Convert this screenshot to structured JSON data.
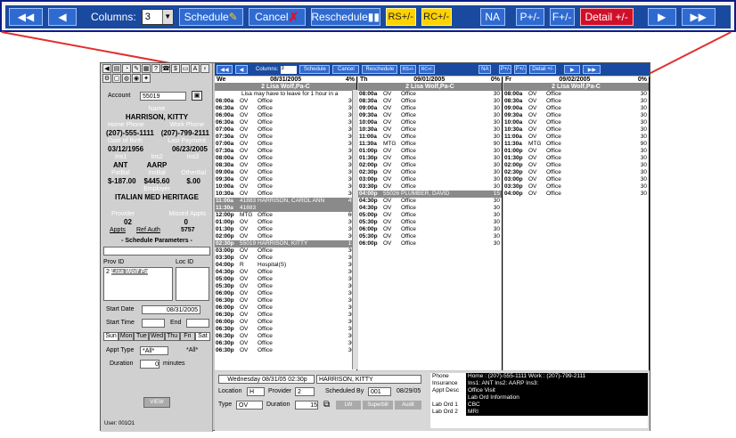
{
  "zoom": {
    "columns_label": "Columns:",
    "columns_value": "3",
    "schedule": "Schedule",
    "cancel": "Cancel",
    "reschedule": "Reschedule",
    "rs": "RS+/-",
    "rc": "RC+/-",
    "na": "NA",
    "p": "P+/-",
    "f": "F+/-",
    "detail": "Detail +/-"
  },
  "left": {
    "account_label": "Account",
    "account": "55019",
    "name_label": "Name",
    "name": "HARRISON, KITTY",
    "home_label": "Home Phone",
    "work_label": "Work Phone",
    "home": "(207)-555-1111",
    "work": "(207)-799-2111",
    "dob_label": "Date of Birth",
    "lastpay_label": "Last Payment",
    "dob": "03/12/1956",
    "lastpay": "06/23/2005",
    "ins1_label": "Ins1",
    "ins2_label": "Ins2",
    "ins3_label": "Ins3",
    "ins1": "ANT",
    "ins2": "AARP",
    "pat_label": "PatBal",
    "ins_label": "InsBal",
    "oth_label": "OtherBal",
    "pat": "$-187.00",
    "insbal": "$445.60",
    "oth": "$.00",
    "employer_label": "Employer",
    "employer": "ITALIAN MED HERITAGE",
    "prov_label": "Provider",
    "missed_label": "Missed Appts",
    "prov": "02",
    "missed": "0",
    "appts": "Appts",
    "refauth": "Ref Auth",
    "refnum": "5757",
    "sched_params": "- Schedule Parameters -",
    "provid": "Prov ID",
    "locid": "Loc ID",
    "provsel": "2",
    "provname": "Lisa Wolf Pa",
    "startdate_label": "Start Date",
    "startdate": "08/31/2005",
    "starttime_label": "Start Time",
    "end_label": "End",
    "days": [
      "Sun",
      "Mon",
      "Tue",
      "Wed",
      "Thu",
      "Fri",
      "Sat"
    ],
    "appttype_label": "Appt Type",
    "appttype": "*All*",
    "appttype2": "*All*",
    "duration_label": "Duration",
    "duration": "0",
    "minutes": "minutes",
    "view": "VIEW",
    "user": "User: 001O1"
  },
  "cols": [
    {
      "day": "We",
      "date": "08/31/2005",
      "pct": "4%",
      "prov": "2 Lisa Wolf,Pa-C",
      "note": "Lisa may have to leave for 1 hour in a",
      "rows": [
        [
          "06:00a",
          "OV",
          "Office",
          "30"
        ],
        [
          "06:30a",
          "OV",
          "Office",
          "30"
        ],
        [
          "06:00a",
          "OV",
          "Office",
          "30"
        ],
        [
          "06:30a",
          "OV",
          "Office",
          "30"
        ],
        [
          "07:00a",
          "OV",
          "Office",
          "30"
        ],
        [
          "07:30a",
          "OV",
          "Office",
          "30"
        ],
        [
          "07:00a",
          "OV",
          "Office",
          "30"
        ],
        [
          "07:30a",
          "OV",
          "Office",
          "30"
        ],
        [
          "08:00a",
          "OV",
          "Office",
          "30"
        ],
        [
          "08:30a",
          "OV",
          "Office",
          "30"
        ],
        [
          "09:00a",
          "OV",
          "Office",
          "30"
        ],
        [
          "09:30a",
          "OV",
          "Office",
          "30"
        ],
        [
          "10:00a",
          "OV",
          "Office",
          "30"
        ],
        [
          "10:30a",
          "OV",
          "Office",
          "30"
        ],
        [
          "11:00a",
          "41883",
          "HARRISON, CAROL ANN",
          "45",
          1
        ],
        [
          "11:30a",
          "41883",
          "",
          "",
          1
        ],
        [
          "12:00p",
          "MTG",
          "Office",
          "60"
        ],
        [
          "01:00p",
          "OV",
          "Office",
          "30"
        ],
        [
          "01:30p",
          "OV",
          "Office",
          "30"
        ],
        [
          "02:00p",
          "OV",
          "Office",
          "30"
        ],
        [
          "02:30p",
          "55019",
          "HARRISON, KITTY",
          "15",
          1
        ],
        [
          "03:00p",
          "OV",
          "Office",
          "30"
        ],
        [
          "03:30p",
          "OV",
          "Office",
          "30"
        ],
        [
          "04:00p",
          "R",
          "Hospital(S)",
          "30"
        ],
        [
          "04:30p",
          "OV",
          "Office",
          "30"
        ],
        [
          "05:00p",
          "OV",
          "Office",
          "30"
        ],
        [
          "05:30p",
          "OV",
          "Office",
          "30"
        ],
        [
          "06:00p",
          "OV",
          "Office",
          "30"
        ],
        [
          "06:30p",
          "OV",
          "Office",
          "30"
        ],
        [
          "06:00p",
          "OV",
          "Office",
          "30"
        ],
        [
          "06:30p",
          "OV",
          "Office",
          "30"
        ],
        [
          "06:00p",
          "OV",
          "Office",
          "30"
        ],
        [
          "06:30p",
          "OV",
          "Office",
          "30"
        ],
        [
          "06:30p",
          "OV",
          "Office",
          "30"
        ],
        [
          "06:30p",
          "OV",
          "Office",
          "30"
        ],
        [
          "06:30p",
          "OV",
          "Office",
          "30"
        ]
      ]
    },
    {
      "day": "Th",
      "date": "09/01/2005",
      "pct": "0%",
      "prov": "2 Lisa Wolf,Pa-C",
      "note": "",
      "rows": [
        [
          "08:00a",
          "OV",
          "Office",
          "30"
        ],
        [
          "08:30a",
          "OV",
          "Office",
          "30"
        ],
        [
          "09:00a",
          "OV",
          "Office",
          "30"
        ],
        [
          "09:30a",
          "OV",
          "Office",
          "30"
        ],
        [
          "10:00a",
          "OV",
          "Office",
          "30"
        ],
        [
          "10:30a",
          "OV",
          "Office",
          "30"
        ],
        [
          "11:00a",
          "OV",
          "Office",
          "30"
        ],
        [
          "11:30a",
          "MTG",
          "Office",
          "90"
        ],
        [
          "01:00p",
          "OV",
          "Office",
          "30"
        ],
        [
          "01:30p",
          "OV",
          "Office",
          "30"
        ],
        [
          "02:00p",
          "OV",
          "Office",
          "30"
        ],
        [
          "02:30p",
          "OV",
          "Office",
          "30"
        ],
        [
          "03:00p",
          "OV",
          "Office",
          "30"
        ],
        [
          "03:30p",
          "OV",
          "Office",
          "30"
        ],
        [
          "04:00p",
          "55026",
          "PLUMBER, DAVID",
          "15",
          1
        ],
        [
          "04:30p",
          "OV",
          "Office",
          "30"
        ],
        [
          "04:30p",
          "OV",
          "Office",
          "30"
        ],
        [
          "05:00p",
          "OV",
          "Office",
          "30"
        ],
        [
          "05:30p",
          "OV",
          "Office",
          "30"
        ],
        [
          "06:00p",
          "OV",
          "Office",
          "30"
        ],
        [
          "05:30p",
          "OV",
          "Office",
          "30"
        ],
        [
          "06:00p",
          "OV",
          "Office",
          "30"
        ]
      ]
    },
    {
      "day": "Fr",
      "date": "09/02/2005",
      "pct": "0%",
      "prov": "2 Lisa Wolf,Pa-C",
      "note": "",
      "rows": [
        [
          "08:00a",
          "OV",
          "Office",
          "30"
        ],
        [
          "08:30a",
          "OV",
          "Office",
          "30"
        ],
        [
          "09:00a",
          "OV",
          "Office",
          "30"
        ],
        [
          "09:30a",
          "OV",
          "Office",
          "30"
        ],
        [
          "10:00a",
          "OV",
          "Office",
          "30"
        ],
        [
          "10:30a",
          "OV",
          "Office",
          "30"
        ],
        [
          "11:00a",
          "OV",
          "Office",
          "30"
        ],
        [
          "11:30a",
          "MTG",
          "Office",
          "90"
        ],
        [
          "01:00p",
          "OV",
          "Office",
          "30"
        ],
        [
          "01:30p",
          "OV",
          "Office",
          "30"
        ],
        [
          "02:00p",
          "OV",
          "Office",
          "30"
        ],
        [
          "02:30p",
          "OV",
          "Office",
          "30"
        ],
        [
          "03:00p",
          "OV",
          "Office",
          "30"
        ],
        [
          "03:30p",
          "OV",
          "Office",
          "30"
        ],
        [
          "04:00p",
          "OV",
          "Office",
          "30"
        ]
      ]
    }
  ],
  "bottom": {
    "when": "Wednesday 08/31/05 02:30p",
    "who": "HARRISON, KITTY",
    "loc_label": "Location",
    "loc": "H",
    "provider_label": "Provider",
    "provider": "2",
    "schedby_label": "Scheduled By",
    "schedby": "001",
    "schedby_date": "08/29/05",
    "type_label": "Type",
    "type": "OV",
    "dur_label": "Duration",
    "dur": "15",
    "lw": "LW",
    "superbill": "Superbill",
    "audit": "Audit",
    "info": [
      [
        "Phone",
        "Home : (207)-555-1111   Work : (207)-799-2111"
      ],
      [
        "Insurance",
        "Ins1: ANT   Ins2: AARP   Ins3:"
      ],
      [
        "Appt Desc",
        "Office Visit"
      ],
      [
        "",
        "Lab Ord Information"
      ],
      [
        "Lab Ord 1",
        "CBC"
      ],
      [
        "Lab Ord 2",
        "MRI"
      ]
    ]
  }
}
